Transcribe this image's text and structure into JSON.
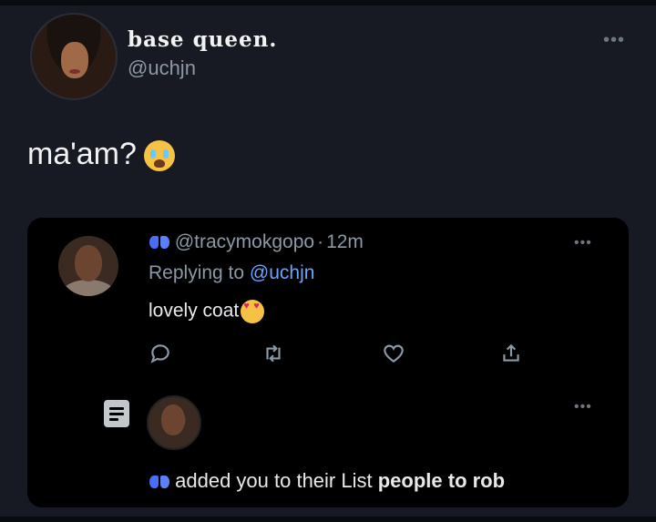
{
  "tweet": {
    "display_name": "base queen.",
    "handle": "@uchjn",
    "text": "ma'am?",
    "emoji": "loudly-crying-face"
  },
  "reply": {
    "handle": "@tracymokgopo",
    "separator": "·",
    "time": "12m",
    "replying_prefix": "Replying to",
    "replying_to": "@uchjn",
    "text": "lovely coat",
    "emoji": "heart-eyes-face",
    "actions": [
      "reply-icon",
      "retweet-icon",
      "like-icon",
      "share-icon"
    ]
  },
  "notification": {
    "text_prefix": "added you to their List",
    "list_name": "people to rob"
  },
  "colors": {
    "background": "#171a22",
    "card": "#000000",
    "muted": "#8b98a5",
    "mention": "#6ba4ff",
    "butterfly": "#4a6cf7"
  }
}
